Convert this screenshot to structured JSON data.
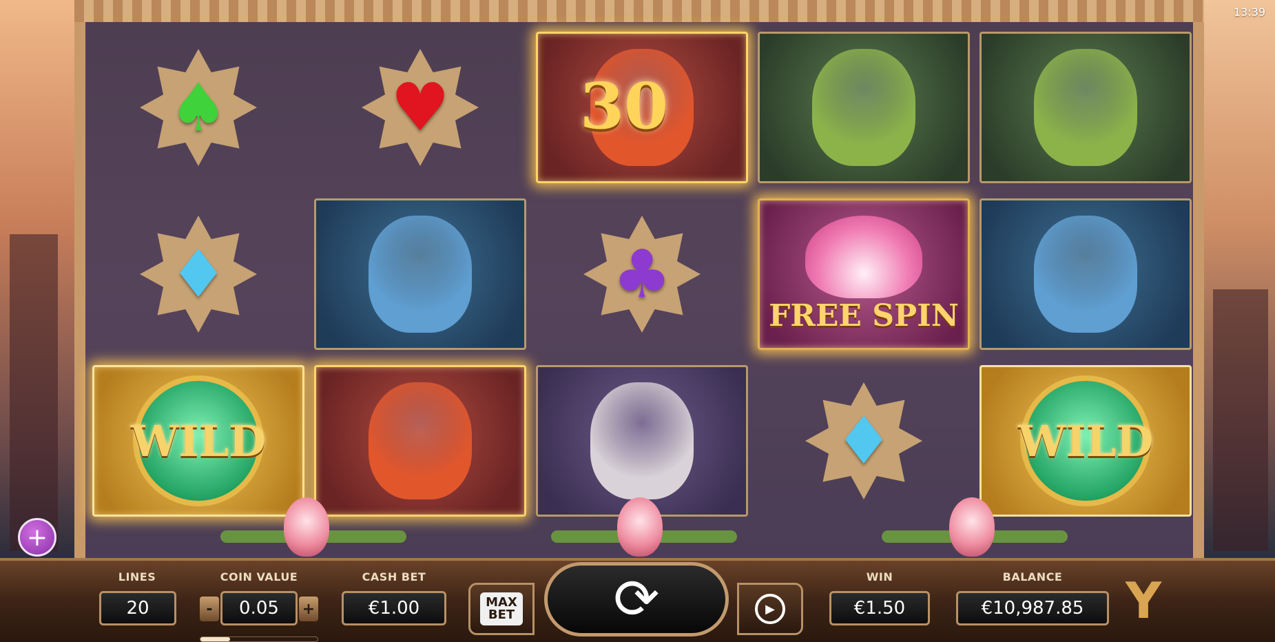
{
  "status": {
    "clock": "13:39"
  },
  "reels": {
    "rows": [
      [
        {
          "kind": "suit",
          "symbol": "spade",
          "glyph": "♠",
          "color": "#3fd23a"
        },
        {
          "kind": "suit",
          "symbol": "heart",
          "glyph": "♥",
          "color": "#e0151f"
        },
        {
          "kind": "animal",
          "symbol": "phoenix",
          "tile": "red",
          "overlay": "30",
          "highlighted": true
        },
        {
          "kind": "animal",
          "symbol": "cobra",
          "tile": "green"
        },
        {
          "kind": "animal",
          "symbol": "cobra",
          "tile": "green"
        }
      ],
      [
        {
          "kind": "suit",
          "symbol": "diamond",
          "glyph": "♦",
          "color": "#52c7f0"
        },
        {
          "kind": "animal",
          "symbol": "griffin",
          "tile": "blue"
        },
        {
          "kind": "suit",
          "symbol": "club",
          "glyph": "♣",
          "color": "#8d3ad0"
        },
        {
          "kind": "scatter",
          "symbol": "lotus",
          "tile": "pink",
          "label": "FREE SPIN"
        },
        {
          "kind": "animal",
          "symbol": "griffin",
          "tile": "blue"
        }
      ],
      [
        {
          "kind": "wild",
          "symbol": "wild",
          "label": "WILD",
          "highlighted": true
        },
        {
          "kind": "animal",
          "symbol": "phoenix",
          "tile": "red",
          "highlighted": true
        },
        {
          "kind": "animal",
          "symbol": "jackalope",
          "tile": "purple"
        },
        {
          "kind": "suit",
          "symbol": "diamond",
          "glyph": "♦",
          "color": "#52c7f0"
        },
        {
          "kind": "wild",
          "symbol": "wild",
          "label": "WILD"
        }
      ]
    ]
  },
  "controls": {
    "plus_button": "+",
    "lines": {
      "label": "LINES",
      "value": "20"
    },
    "coin_value": {
      "label": "COIN VALUE",
      "value": "0.05",
      "decrease": "-",
      "increase": "+",
      "slider_fraction": 0.25
    },
    "cash_bet": {
      "label": "CASH BET",
      "value": "€1.00"
    },
    "max_bet": {
      "line1": "MAX",
      "line2": "BET"
    },
    "spin_icon": "⟳",
    "autoplay_icon": "▶",
    "win": {
      "label": "WIN",
      "value": "€1.50"
    },
    "balance": {
      "label": "BALANCE",
      "value": "€10,987.85"
    },
    "logo_glyph": "Y"
  },
  "colors": {
    "frame": "#c89a6a",
    "panel": "#3d2416",
    "highlight": "#ffd36a",
    "accent_gold": "#f7d36b"
  }
}
